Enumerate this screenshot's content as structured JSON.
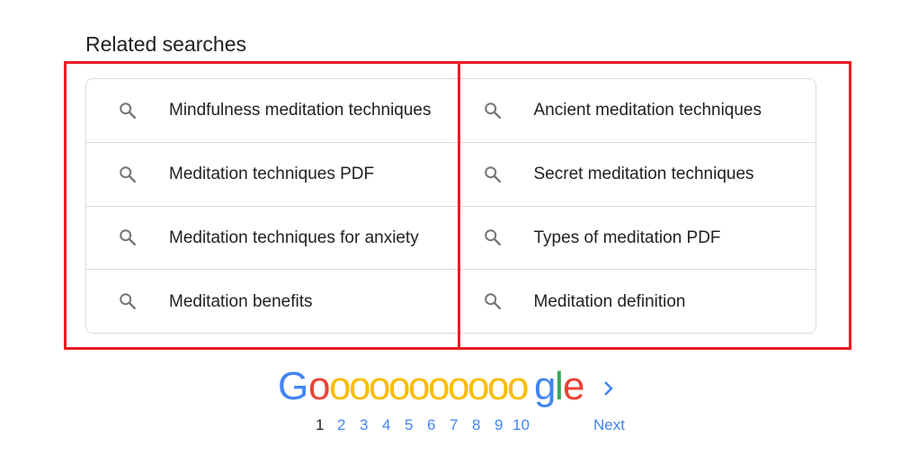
{
  "related": {
    "heading": "Related searches",
    "left": [
      {
        "label": "Mindfulness meditation techniques"
      },
      {
        "label": "Meditation techniques PDF"
      },
      {
        "label": "Meditation techniques for anxiety"
      },
      {
        "label": "Meditation benefits"
      }
    ],
    "right": [
      {
        "label": "Ancient meditation techniques"
      },
      {
        "label": "Secret meditation techniques"
      },
      {
        "label": "Types of meditation PDF"
      },
      {
        "label": "Meditation definition"
      }
    ]
  },
  "pagination": {
    "logo_letters": [
      "G",
      "o",
      "o",
      "o",
      "o",
      "o",
      "o",
      "o",
      "o",
      "o",
      "o",
      "o",
      "g",
      "l",
      "e"
    ],
    "pages": [
      "1",
      "2",
      "3",
      "4",
      "5",
      "6",
      "7",
      "8",
      "9",
      "10"
    ],
    "current_page": "1",
    "next_label": "Next"
  },
  "colors": {
    "blue": "#4285f4",
    "red": "#ea4335",
    "yellow": "#fbbc05",
    "green": "#34a853",
    "highlight": "#ed1c24"
  }
}
